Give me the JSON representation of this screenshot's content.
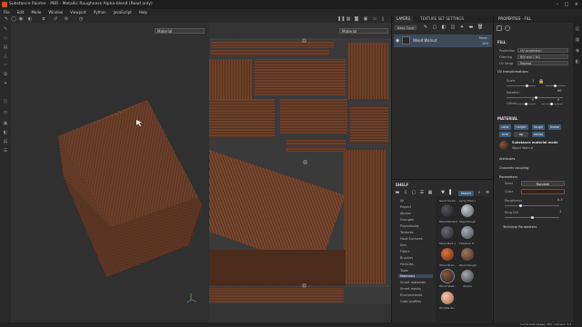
{
  "window": {
    "title": "Substance Painter - PBR - Metallic Roughness Alpha-blend (Read only)"
  },
  "menu": [
    "File",
    "Edit",
    "Mode",
    "Window",
    "Viewport",
    "Python",
    "JavaScript",
    "Help"
  ],
  "viewport": {
    "left_dropdown": "Material",
    "right_dropdown": "Material"
  },
  "layers": {
    "tab_layers": "LAYERS",
    "tab_texture_set": "TEXTURE SET SETTINGS",
    "base_color_dropdown": "Base Color",
    "layer_name": "Wood Walnut",
    "blend_mode": "Norm",
    "opacity": "100"
  },
  "shelf": {
    "title": "SHELF",
    "filter_chip": "Materi",
    "categories": [
      "All",
      "Project",
      "Alphas",
      "Grunges",
      "Procedurals",
      "Textures",
      "Hard Surfaces",
      "Skin",
      "Filters",
      "Brushes",
      "Particles",
      "Tools",
      "Materials",
      "Smart materials",
      "Smart masks",
      "Environments",
      "Color profiles"
    ],
    "selected_category": "Materials",
    "materials": [
      {
        "label": "Good Scratc",
        "color": "#6f6a5e"
      },
      {
        "label": "Iging Tiled (",
        "color": "#8a8f96"
      },
      {
        "label": "Steel Painted",
        "color": "#2b2b2f"
      },
      {
        "label": "Steel Rough",
        "color": "#8e9299"
      },
      {
        "label": "Steel Rust a",
        "color": "#3b3c40"
      },
      {
        "label": "Titanium P...",
        "color": "#6c7078"
      },
      {
        "label": "Wood Bran...",
        "color": "#b0532a"
      },
      {
        "label": "Wood Rough",
        "color": "#7a5840"
      },
      {
        "label": "Wood Walt...",
        "color": "#5a3a27"
      },
      {
        "label": "Zippel",
        "color": "#7d7f84"
      },
      {
        "label": "Zombie Sk...",
        "color": "#d9a489"
      }
    ]
  },
  "properties": {
    "title": "PROPERTIES - FILL",
    "fill_section": "FILL",
    "projection_label": "Projection",
    "projection_value": "UV projection",
    "filtering_label": "Filtering",
    "filtering_value": "Bilinear | HQ",
    "uvwrap_label": "UV Wrap",
    "uvwrap_value": "Repeat",
    "uv_section": "UV transformations",
    "scale_label": "Scale",
    "scale_value": "1",
    "rotation_label": "Rotation",
    "rotation_value": "90",
    "offset_label": "Offset",
    "offset_x": "0",
    "offset_y": "0",
    "material_section": "MATERIAL",
    "channels": [
      {
        "label": "color",
        "on": true
      },
      {
        "label": "height",
        "on": true
      },
      {
        "label": "rough",
        "on": true
      },
      {
        "label": "metal",
        "on": true
      },
      {
        "label": "nrm",
        "on": true
      },
      {
        "label": "op",
        "on": false
      },
      {
        "label": "emiss",
        "on": true
      }
    ],
    "material_mode_title": "Substance material mode",
    "material_mode_sub": "Wood Walnut",
    "attributes_section": "Attributes",
    "channels_coupling_section": "Channels coupling",
    "parameters_section": "Parameters",
    "seed_label": "Seed",
    "seed_value": "Random",
    "color_label": "Color",
    "color_swatch": "#3a2117",
    "roughness_label": "Roughness",
    "roughness_value": "0.3",
    "ring_dirt_label": "Ring Dirt",
    "ring_dirt_value": "1",
    "technical_section": "Technical Parameters"
  },
  "status": {
    "text": "Cache Disk Usage:   36% | Version: 5.2"
  }
}
